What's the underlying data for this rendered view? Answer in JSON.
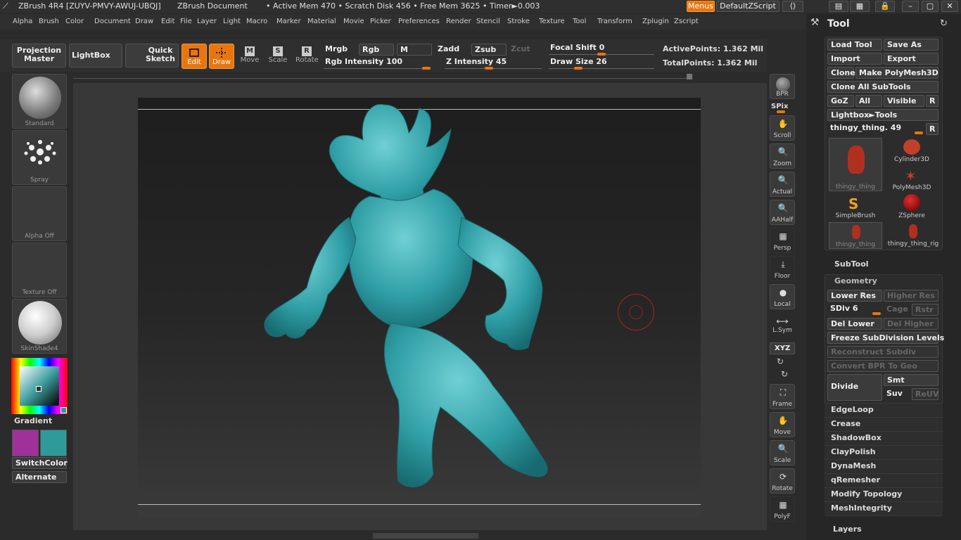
{
  "titlebar": {
    "app": "ZBrush 4R4 [ZUYV-PMVY-AWUJ-UBQJ]",
    "document": "ZBrush Document",
    "stats": "• Active Mem 470 • Scratch Disk 456 • Free Mem 3625 • Timer►0.003",
    "menus_btn": "Menus",
    "script_btn": "DefaultZScript"
  },
  "menubar": [
    "Alpha",
    "Brush",
    "Color",
    "Document",
    "Draw",
    "Edit",
    "File",
    "Layer",
    "Light",
    "Macro",
    "Marker",
    "Material",
    "Movie",
    "Picker",
    "Preferences",
    "Render",
    "Stencil",
    "Stroke",
    "Texture",
    "Tool",
    "Transform",
    "Zplugin",
    "Zscript"
  ],
  "toolbar": {
    "projection_master": "Projection Master",
    "lightbox": "LightBox",
    "quick_sketch": "Quick Sketch",
    "edit": "Edit",
    "draw": "Draw",
    "move": "Move",
    "scale": "Scale",
    "rotate": "Rotate",
    "mrgb": "Mrgb",
    "rgb": "Rgb",
    "m": "M",
    "zadd": "Zadd",
    "zsub": "Zsub",
    "zcut": "Zcut",
    "rgb_intensity": "Rgb Intensity 100",
    "z_intensity": "Z Intensity 45",
    "focal_shift": "Focal Shift 0",
    "draw_size": "Draw Size 26",
    "active_points": "ActivePoints: 1.362 Mil",
    "total_points": "TotalPoints: 1.362 Mil",
    "rgb_intensity_level": 1.0,
    "z_intensity_level": 0.45,
    "focal_shift_level": 0.5,
    "draw_size_level": 0.26
  },
  "leftshelf": {
    "brush": "Standard",
    "stroke": "Spray",
    "alpha": "Alpha Off",
    "texture": "Texture Off",
    "material": "SkinShade4",
    "gradient": "Gradient",
    "switchcolor": "SwitchColor",
    "alternate": "Alternate",
    "main_color": "#a0309a",
    "secondary_color": "#2e9a9a"
  },
  "rightshelf": {
    "bpr": "BPR",
    "spix": "SPix",
    "items": [
      "Scroll",
      "Zoom",
      "Actual",
      "AAHalf",
      "Persp",
      "Floor",
      "Local",
      "L.Sym",
      "XYZ",
      "Frame",
      "Move",
      "Scale",
      "Rotate",
      "PolyF"
    ]
  },
  "panel": {
    "title": "Tool",
    "load_tool": "Load Tool",
    "save_as": "Save As",
    "import": "Import",
    "export": "Export",
    "clone": "Clone",
    "make_polymesh": "Make PolyMesh3D",
    "clone_all": "Clone All SubTools",
    "goz": "GoZ",
    "all": "All",
    "visible": "Visible",
    "r": "R",
    "lightbox_tools": "Lightbox►Tools",
    "tool_slider": "thingy_thing. 49",
    "tools": [
      "thingy_thing",
      "Cylinder3D",
      "PolyMesh3D",
      "SimpleBrush",
      "ZSphere",
      "thingy_thing",
      "thingy_thing_rig"
    ],
    "subtool": "SubTool",
    "geometry": "Geometry",
    "lower_res": "Lower Res",
    "higher_res": "Higher Res",
    "sdiv": "SDiv 6",
    "cage": "Cage",
    "rstr": "Rstr",
    "del_lower": "Del Lower",
    "del_higher": "Del Higher",
    "freeze": "Freeze SubDivision Levels",
    "reconstruct": "Reconstruct Subdiv",
    "convert_bpr": "Convert BPR To Geo",
    "divide": "Divide",
    "smt": "Smt",
    "suv": "Suv",
    "reuv": "ReUV",
    "sections": [
      "EdgeLoop",
      "Crease",
      "ShadowBox",
      "ClayPolish",
      "DynaMesh",
      "qRemesher",
      "Modify Topology",
      "MeshIntegrity"
    ],
    "layers": "Layers"
  }
}
